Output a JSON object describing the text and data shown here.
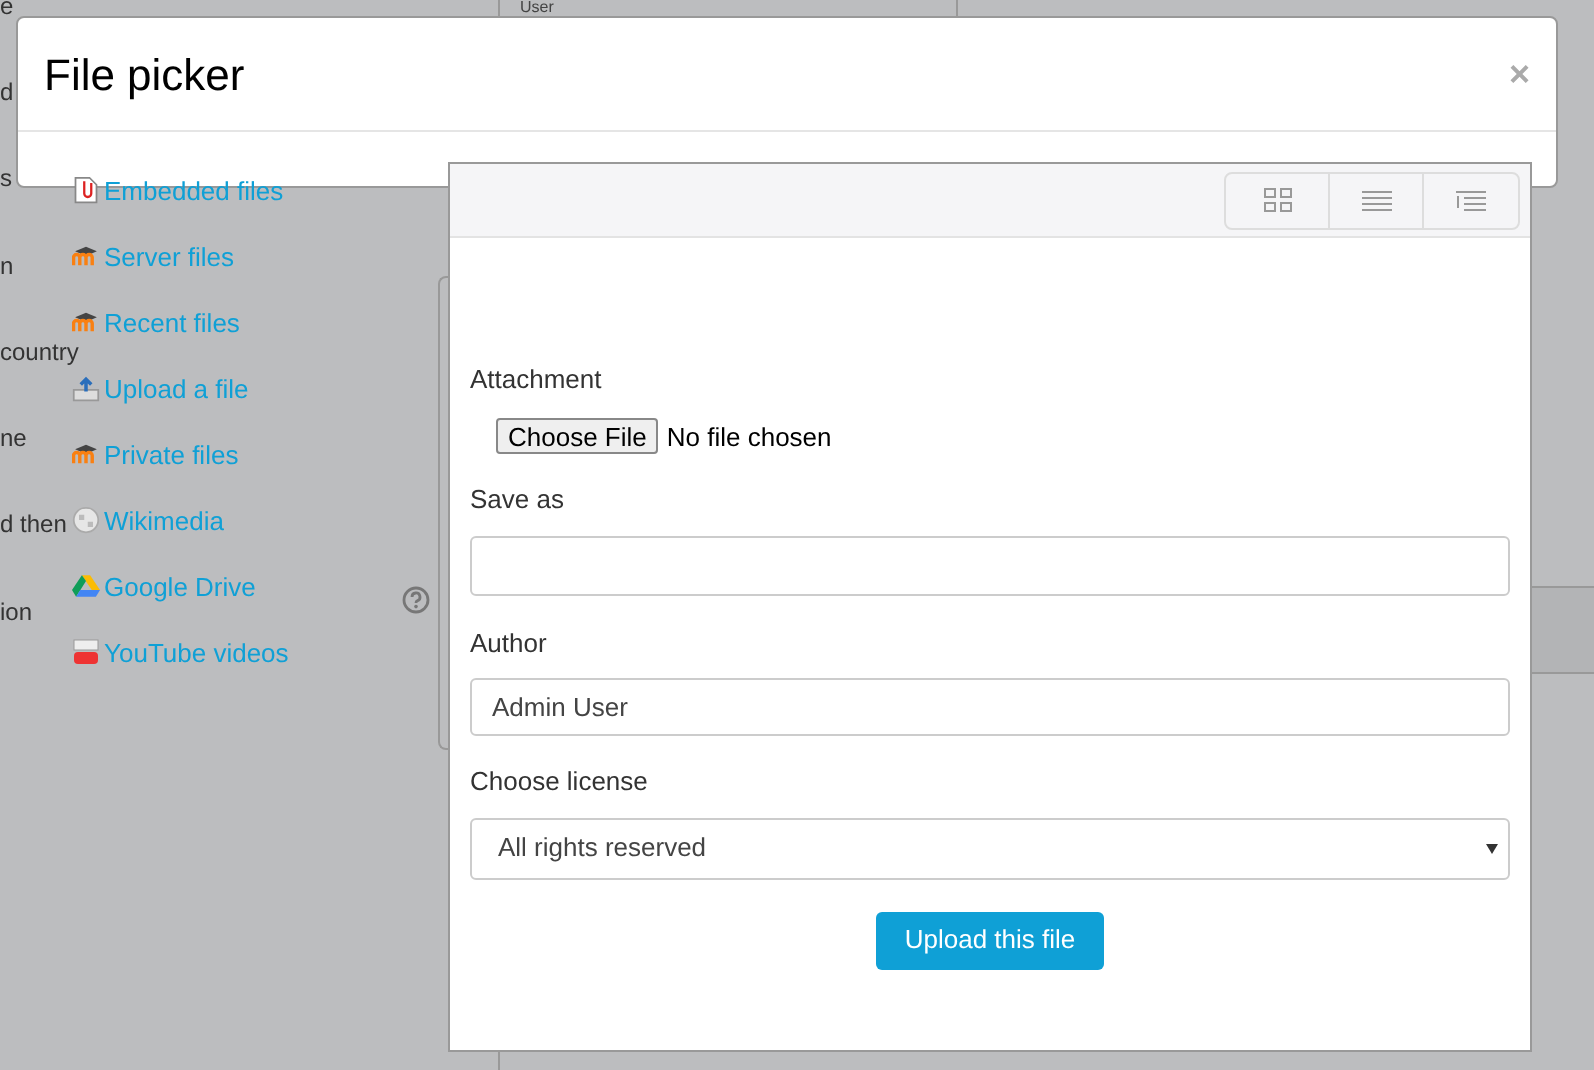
{
  "background": {
    "column_header": "User",
    "fragments": [
      "e",
      "d",
      "s",
      "n",
      "country",
      "ne",
      "d then",
      "ion"
    ]
  },
  "dialog": {
    "title": "File picker",
    "close": "×",
    "repositories": [
      {
        "label": "Embedded files",
        "kind": "file"
      },
      {
        "label": "Server files",
        "kind": "moodle"
      },
      {
        "label": "Recent files",
        "kind": "moodle"
      },
      {
        "label": "Upload a file",
        "kind": "upload"
      },
      {
        "label": "Private files",
        "kind": "moodle"
      },
      {
        "label": "Wikimedia",
        "kind": "globe"
      },
      {
        "label": "Google Drive",
        "kind": "drive"
      },
      {
        "label": "YouTube videos",
        "kind": "youtube"
      }
    ],
    "form": {
      "attachment_label": "Attachment",
      "choose_button": "Choose File",
      "file_status": "No file chosen",
      "save_as_label": "Save as",
      "author_label": "Author",
      "author_value": "Admin User",
      "license_label": "Choose license",
      "license_value": "All rights reserved",
      "submit": "Upload this file"
    }
  }
}
